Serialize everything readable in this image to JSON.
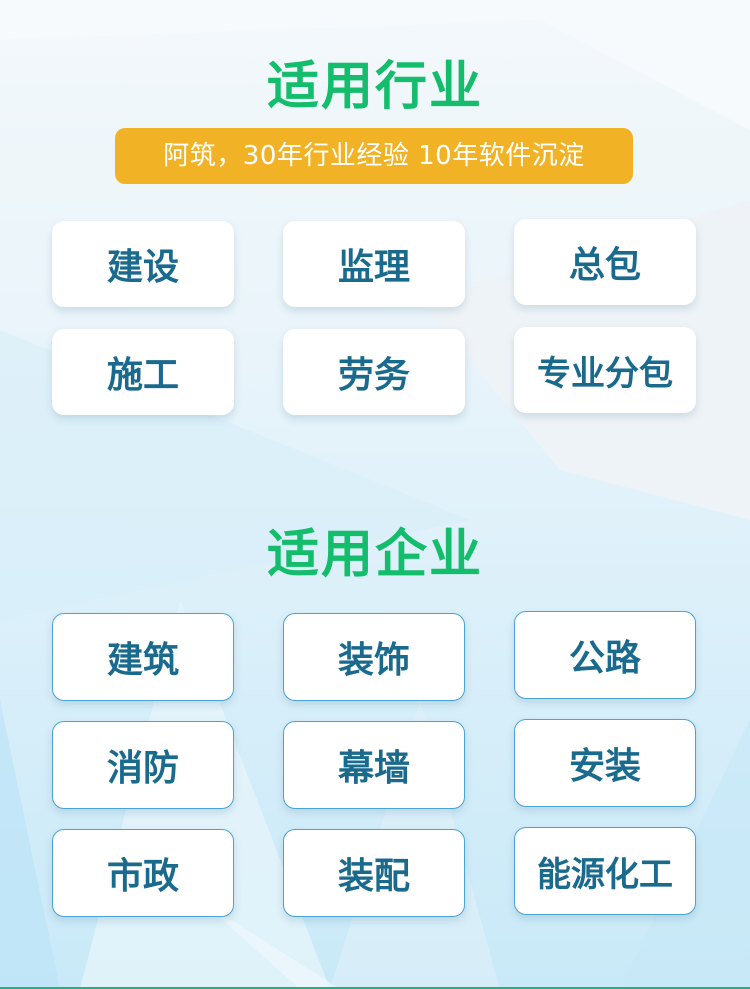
{
  "colors": {
    "title_green": "#13bd6c",
    "banner_yellow": "#f1b325",
    "card_text": "#1a6a8e",
    "card_border": "#4aa3d2",
    "bottom_line": "#1fb27a"
  },
  "section_industry": {
    "title": "适用行业",
    "banner": "阿筑，30年行业经验 10年软件沉淀",
    "items": [
      "建设",
      "监理",
      "总包",
      "施工",
      "劳务",
      "专业分包"
    ]
  },
  "section_enterprise": {
    "title": "适用企业",
    "items": [
      "建筑",
      "装饰",
      "公路",
      "消防",
      "幕墙",
      "安装",
      "市政",
      "装配",
      "能源化工"
    ]
  }
}
